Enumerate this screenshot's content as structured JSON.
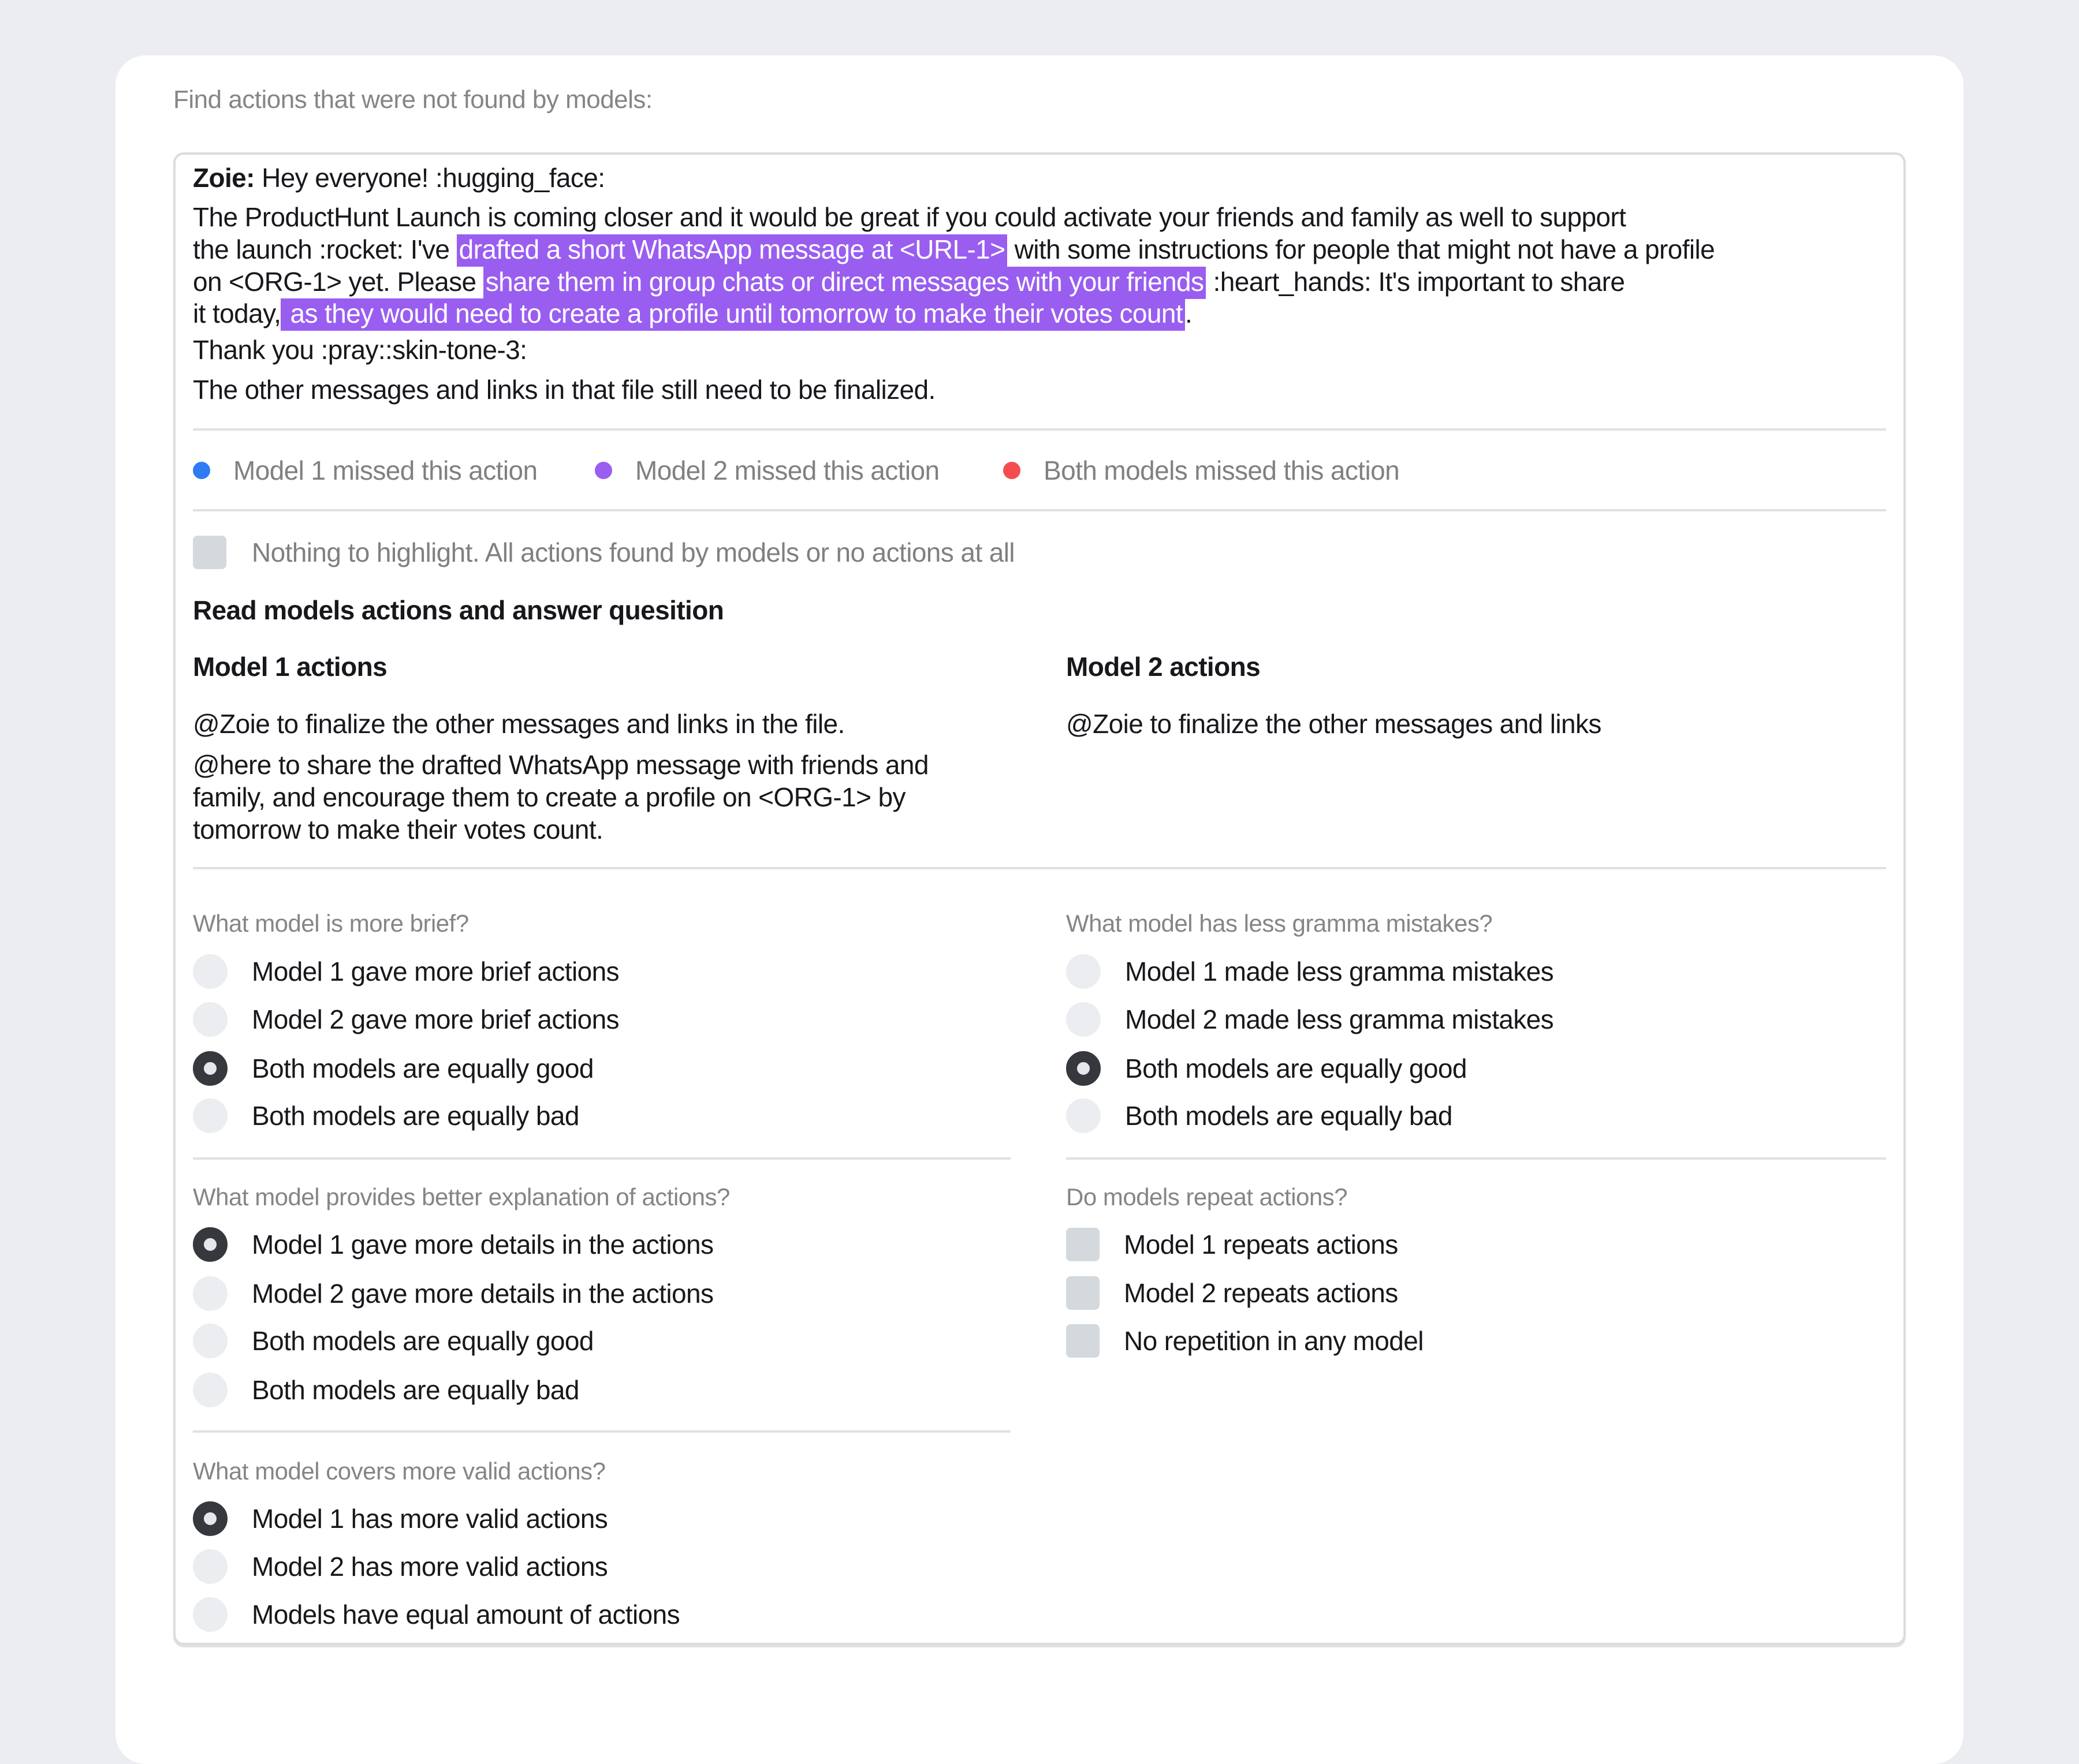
{
  "section_label": "Find actions that were not found by models:",
  "message": {
    "author": "Zoie:",
    "greeting": " Hey everyone! :hugging_face:",
    "para_line1": "The ProductHunt Launch is coming closer and it would be great if you could activate your friends and family as well to support",
    "para_line2_pre": "the launch :rocket: I've ",
    "highlight1": "drafted a short WhatsApp message at <URL-1>",
    "para_line2_post": " with some instructions for people that might not have a profile",
    "para_line3_pre": "on <ORG-1> yet. Please ",
    "highlight2": "share them in group chats or direct messages with your friends",
    "para_line3_post": " :heart_hands: It's important to share",
    "para_line4_pre": "it today,",
    "highlight3": " as they would need to create a profile until tomorrow to make their votes count",
    "para_line4_post": ".",
    "thanks": "Thank you :pray::skin-tone-3:",
    "closing": "The other messages and links in that file still need to be finalized.",
    "highlight_color": "#995ef0"
  },
  "legend": [
    {
      "label": "Model 1 missed this action",
      "color": "#2f7bf5"
    },
    {
      "label": "Model 2 missed this action",
      "color": "#9a5ef0"
    },
    {
      "label": "Both models missed this action",
      "color": "#f44d4d"
    }
  ],
  "nothing_checkbox": {
    "label": "Nothing to highlight. All actions found by models or no actions at all",
    "checked": false
  },
  "read_heading": "Read models actions and answer quesition",
  "model1": {
    "heading": "Model 1 actions",
    "actions": [
      "@Zoie to finalize the other messages and links in the file.",
      "@here to share the drafted WhatsApp message with friends and family, and encourage them to create a profile on <ORG-1> by tomorrow to make their votes count."
    ]
  },
  "model2": {
    "heading": "Model 2 actions",
    "actions": [
      "@Zoie to finalize the other messages and links"
    ]
  },
  "questions": {
    "brief": {
      "label": "What model is more brief?",
      "options": [
        "Model 1 gave more brief actions",
        "Model 2 gave more brief actions",
        "Both models are equally good",
        "Both models are equally bad"
      ],
      "selected": 2
    },
    "grammar": {
      "label": "What model has less gramma mistakes?",
      "options": [
        "Model 1 made less gramma mistakes",
        "Model 2 made less gramma mistakes",
        "Both models are equally good",
        "Both models are equally bad"
      ],
      "selected": 2
    },
    "explanation": {
      "label": "What model provides better explanation of actions?",
      "options": [
        "Model 1 gave more details in the actions",
        "Model 2 gave more details in the actions",
        "Both models are equally good",
        "Both models are equally bad"
      ],
      "selected": 0
    },
    "repeat": {
      "label": "Do models repeat actions?",
      "options": [
        "Model 1 repeats actions",
        "Model 2 repeats actions",
        "No repetition in any model"
      ],
      "checked": [
        false,
        false,
        false
      ]
    },
    "valid": {
      "label": "What model covers more valid actions?",
      "options": [
        "Model 1 has more valid actions",
        "Model 2 has more valid actions",
        "Models have equal amount of actions"
      ],
      "selected": 0
    }
  }
}
